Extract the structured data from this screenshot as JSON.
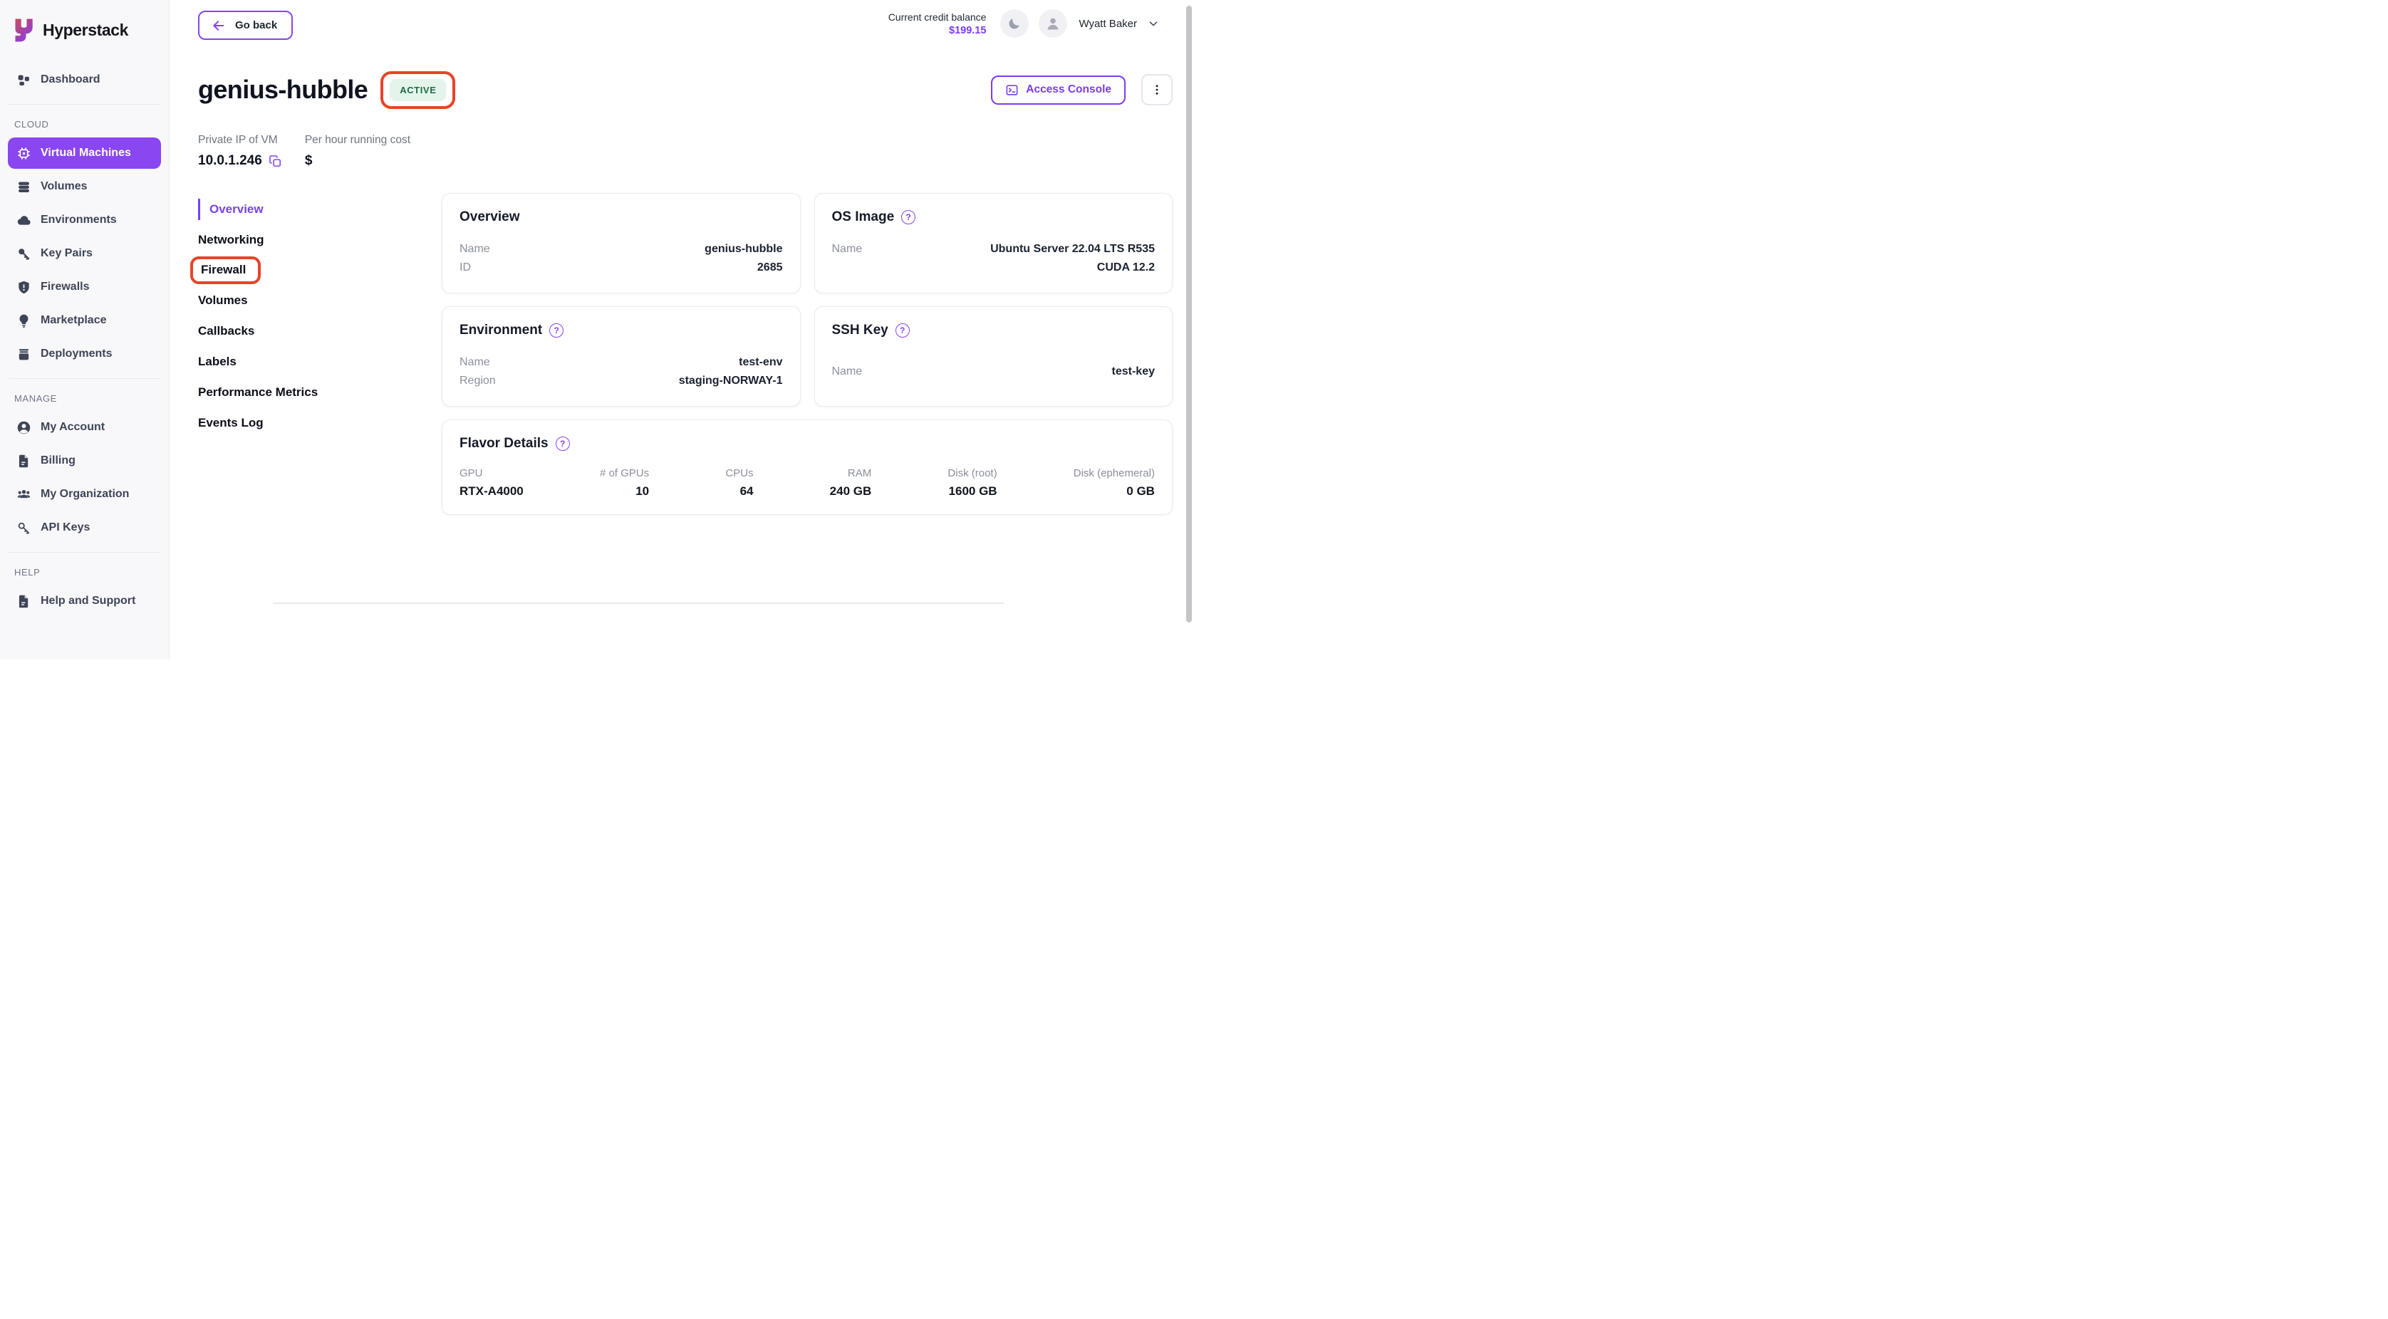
{
  "brand": {
    "name": "Hyperstack"
  },
  "sidebar": {
    "dashboard": "Dashboard",
    "sections": [
      {
        "label": "CLOUD",
        "items": [
          {
            "label": "Virtual Machines",
            "icon": "chip-icon",
            "active": true
          },
          {
            "label": "Volumes",
            "icon": "stack-icon"
          },
          {
            "label": "Environments",
            "icon": "cloud-icon"
          },
          {
            "label": "Key Pairs",
            "icon": "key-icon"
          },
          {
            "label": "Firewalls",
            "icon": "shield-alert-icon"
          },
          {
            "label": "Marketplace",
            "icon": "lightbulb-icon"
          },
          {
            "label": "Deployments",
            "icon": "archive-icon"
          }
        ]
      },
      {
        "label": "MANAGE",
        "items": [
          {
            "label": "My Account",
            "icon": "user-circle-icon"
          },
          {
            "label": "Billing",
            "icon": "document-icon"
          },
          {
            "label": "My Organization",
            "icon": "people-icon"
          },
          {
            "label": "API Keys",
            "icon": "key-outline-icon"
          }
        ]
      },
      {
        "label": "HELP",
        "items": [
          {
            "label": "Help and Support",
            "icon": "document-icon"
          }
        ]
      }
    ]
  },
  "topbar": {
    "go_back": "Go back",
    "credit_label": "Current credit balance",
    "credit_value": "$199.15",
    "user_name": "Wyatt Baker"
  },
  "header": {
    "title": "genius-hubble",
    "status_badge": "ACTIVE",
    "access_console": "Access Console",
    "private_ip_label": "Private IP of VM",
    "private_ip": "10.0.1.246",
    "cost_label": "Per hour running cost",
    "cost_value": "$"
  },
  "subnav": {
    "items": [
      "Overview",
      "Networking",
      "Firewall",
      "Volumes",
      "Callbacks",
      "Labels",
      "Performance Metrics",
      "Events Log"
    ],
    "active_item": "Overview",
    "annotated_item": "Firewall"
  },
  "cards": {
    "overview": {
      "title": "Overview",
      "rows": [
        {
          "label": "Name",
          "value": "genius-hubble"
        },
        {
          "label": "ID",
          "value": "2685"
        }
      ]
    },
    "os_image": {
      "title": "OS Image",
      "rows": [
        {
          "label": "Name",
          "value": "Ubuntu Server 22.04 LTS R535 CUDA 12.2"
        }
      ]
    },
    "environment": {
      "title": "Environment",
      "rows": [
        {
          "label": "Name",
          "value": "test-env"
        },
        {
          "label": "Region",
          "value": "staging-NORWAY-1"
        }
      ]
    },
    "ssh_key": {
      "title": "SSH Key",
      "rows": [
        {
          "label": "Name",
          "value": "test-key"
        }
      ]
    },
    "flavor": {
      "title": "Flavor Details",
      "columns": [
        {
          "label": "GPU",
          "value": "RTX-A4000"
        },
        {
          "label": "# of GPUs",
          "value": "10"
        },
        {
          "label": "CPUs",
          "value": "64"
        },
        {
          "label": "RAM",
          "value": "240 GB"
        },
        {
          "label": "Disk (root)",
          "value": "1600 GB"
        },
        {
          "label": "Disk (ephemeral)",
          "value": "0 GB"
        }
      ]
    }
  },
  "colors": {
    "accent_purple": "#8544f2",
    "sidebar_active_bg": "#8a46f1",
    "credit_value_purple": "#7b3bf2",
    "status_badge_bg": "#e4f4eb",
    "status_badge_text": "#1e6b43",
    "annotation_red": "#e8432a"
  }
}
